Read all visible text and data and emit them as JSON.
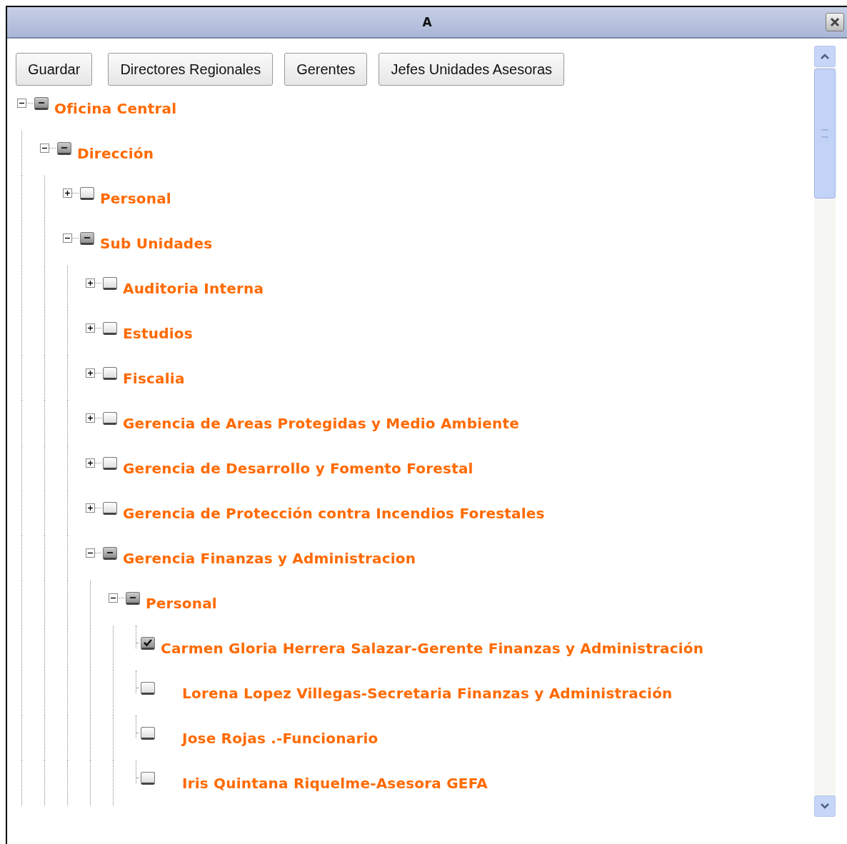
{
  "window": {
    "title": "A"
  },
  "buttons": [
    "Guardar",
    "Directores Regionales",
    "Gerentes",
    "Jefes Unidades Asesoras"
  ],
  "tree": [
    {
      "label": "Oficina Central",
      "expanded": true,
      "checked": false,
      "partial": true,
      "children": [
        {
          "label": "Dirección",
          "expanded": true,
          "checked": false,
          "partial": true,
          "children": [
            {
              "label": "Personal",
              "expanded": false,
              "checked": false,
              "partial": false
            },
            {
              "label": "Sub Unidades",
              "expanded": true,
              "checked": false,
              "partial": true,
              "children": [
                {
                  "label": "Auditoria Interna",
                  "expanded": false,
                  "checked": false,
                  "partial": false
                },
                {
                  "label": "Estudios",
                  "expanded": false,
                  "checked": false,
                  "partial": false
                },
                {
                  "label": "Fiscalia",
                  "expanded": false,
                  "checked": false,
                  "partial": false
                },
                {
                  "label": "Gerencia de Areas Protegidas y Medio Ambiente",
                  "expanded": false,
                  "checked": false,
                  "partial": false
                },
                {
                  "label": "Gerencia de Desarrollo y Fomento Forestal",
                  "expanded": false,
                  "checked": false,
                  "partial": false
                },
                {
                  "label": "Gerencia de Protección contra Incendios Forestales",
                  "expanded": false,
                  "checked": false,
                  "partial": false
                },
                {
                  "label": "Gerencia Finanzas y Administracion",
                  "expanded": true,
                  "checked": false,
                  "partial": true,
                  "children": [
                    {
                      "label": "Personal",
                      "expanded": true,
                      "checked": false,
                      "partial": true,
                      "children": [
                        {
                          "label": "Carmen Gloria Herrera Salazar-Gerente Finanzas y Administración",
                          "kind": "leaf",
                          "checked": true,
                          "partial": false
                        },
                        {
                          "label": "Lorena Lopez Villegas-Secretaria Finanzas y Administración",
                          "kind": "leaf",
                          "checked": false,
                          "partial": false
                        },
                        {
                          "label": "Jose Rojas .-Funcionario",
                          "kind": "leaf",
                          "checked": false,
                          "partial": false
                        },
                        {
                          "label": "Iris Quintana Riquelme-Asesora GEFA",
                          "kind": "leaf",
                          "checked": false,
                          "partial": false
                        }
                      ]
                    }
                  ]
                }
              ]
            }
          ]
        }
      ]
    }
  ]
}
